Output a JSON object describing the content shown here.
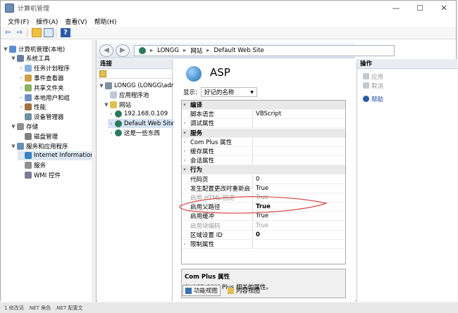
{
  "window": {
    "title": "计算机管理"
  },
  "menu": [
    "文件(F)",
    "操作(A)",
    "查看(V)",
    "帮助(H)"
  ],
  "tree": [
    {
      "label": "计算机管理(本地)",
      "level": 0,
      "expand": "▼"
    },
    {
      "label": "系统工具",
      "level": 1,
      "expand": "▼"
    },
    {
      "label": "任务计划程序",
      "level": 2,
      "expand": "›"
    },
    {
      "label": "事件查看器",
      "level": 2,
      "expand": "›"
    },
    {
      "label": "共享文件夹",
      "level": 2,
      "expand": "›"
    },
    {
      "label": "本地用户和组",
      "level": 2,
      "expand": "›"
    },
    {
      "label": "性能",
      "level": 2,
      "expand": "›"
    },
    {
      "label": "设备管理器",
      "level": 2,
      "expand": ""
    },
    {
      "label": "存储",
      "level": 1,
      "expand": "▼"
    },
    {
      "label": "磁盘管理",
      "level": 2,
      "expand": ""
    },
    {
      "label": "服务和应用程序",
      "level": 1,
      "expand": "▼"
    },
    {
      "label": "Internet Information S",
      "level": 2,
      "expand": ""
    },
    {
      "label": "服务",
      "level": 2,
      "expand": ""
    },
    {
      "label": "WMI 控件",
      "level": 2,
      "expand": ""
    }
  ],
  "address": {
    "segments": [
      "LONGG",
      "网站",
      "Default Web Site"
    ],
    "sep": "▸"
  },
  "connections": {
    "title": "连接",
    "items": [
      {
        "label": "LONGG (LONGG\\admin)",
        "level": 0
      },
      {
        "label": "应用程序池",
        "level": 1
      },
      {
        "label": "网站",
        "level": 1
      },
      {
        "label": "192.168.0.109",
        "level": 2
      },
      {
        "label": "Default Web Site",
        "level": 2
      },
      {
        "label": "这是一些东西",
        "level": 2
      }
    ]
  },
  "main": {
    "title": "ASP",
    "show_label": "显示:",
    "show_value": "好记的名称",
    "rows": [
      {
        "type": "cat",
        "name": "编译",
        "value": ""
      },
      {
        "type": "row",
        "name": "脚本语言",
        "value": "VBScript"
      },
      {
        "type": "row",
        "name": "调试属性",
        "value": "",
        "exp": "›"
      },
      {
        "type": "cat",
        "name": "服务",
        "value": ""
      },
      {
        "type": "row",
        "name": "Com Plus 属性",
        "value": "",
        "exp": "›"
      },
      {
        "type": "row",
        "name": "缓存属性",
        "value": "",
        "exp": "›"
      },
      {
        "type": "row",
        "name": "会话属性",
        "value": "",
        "exp": "›"
      },
      {
        "type": "cat",
        "name": "行为",
        "value": ""
      },
      {
        "type": "row",
        "name": "代码页",
        "value": "0"
      },
      {
        "type": "row",
        "name": "发生配置更改时重新启",
        "value": "True"
      },
      {
        "type": "grey",
        "name": "启用 HTML 回退",
        "value": "True"
      },
      {
        "type": "bold",
        "name": "启用父路径",
        "value": "True"
      },
      {
        "type": "row",
        "name": "启用缓冲",
        "value": "True"
      },
      {
        "type": "grey",
        "name": "启用块编码",
        "value": "True"
      },
      {
        "type": "bold",
        "name": "区域设置 ID",
        "value": "0"
      },
      {
        "type": "row",
        "name": "限制属性",
        "value": "",
        "exp": "›"
      }
    ],
    "desc_title": "Com Plus 属性",
    "desc_text": "与 ASP COM Plus 相关的属性。"
  },
  "tabs": [
    "功能视图",
    "内容视图"
  ],
  "actions": {
    "title": "操作",
    "items": [
      {
        "label": "应用",
        "enabled": false
      },
      {
        "label": "取消",
        "enabled": false
      },
      {
        "label": "帮助",
        "enabled": true
      }
    ]
  },
  "status": [
    "1 修改词",
    ".NET 角色",
    ".NET 配置文"
  ]
}
